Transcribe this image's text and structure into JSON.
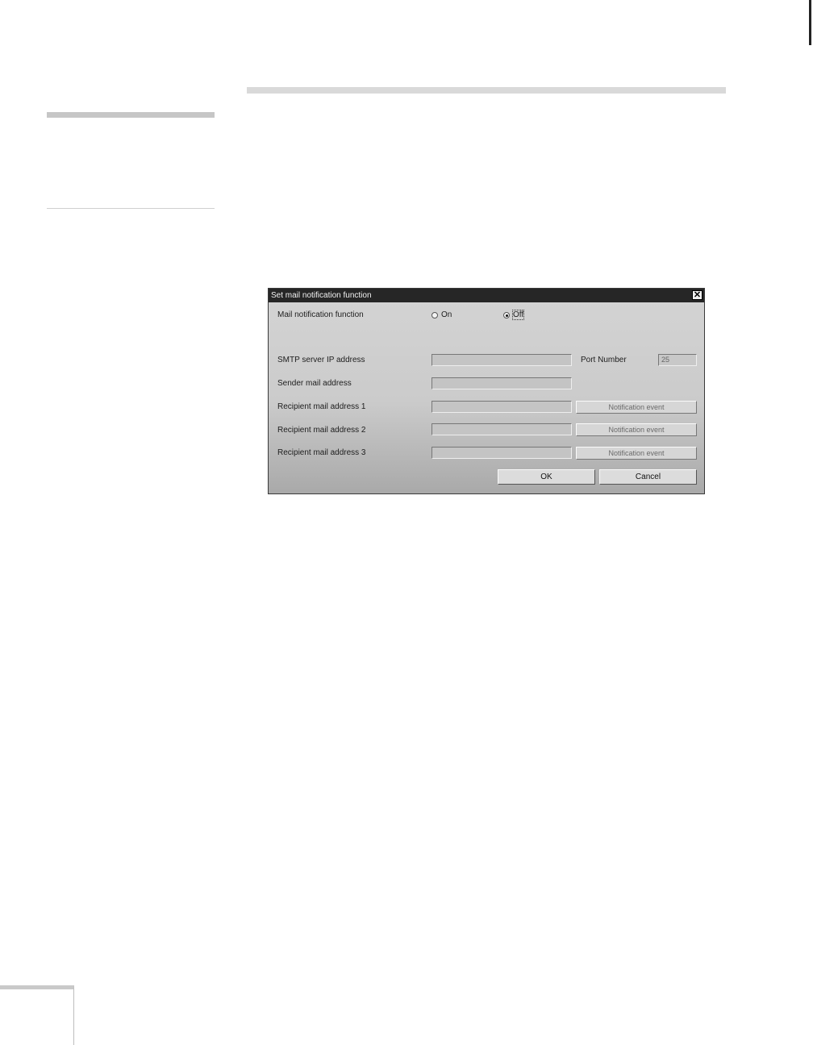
{
  "dialog": {
    "title": "Set mail notification function",
    "close_symbol": "✕",
    "mail_notification_label": "Mail notification function",
    "options": {
      "on": "On",
      "off": "Off",
      "selected": "Off"
    },
    "smtp_label": "SMTP server IP address",
    "port_label": "Port Number",
    "port_value": "25",
    "sender_label": "Sender mail address",
    "recipients": [
      {
        "label": "Recipient mail address 1",
        "button": "Notification event"
      },
      {
        "label": "Recipient mail address 2",
        "button": "Notification event"
      },
      {
        "label": "Recipient mail address 3",
        "button": "Notification event"
      }
    ],
    "ok_label": "OK",
    "cancel_label": "Cancel"
  }
}
